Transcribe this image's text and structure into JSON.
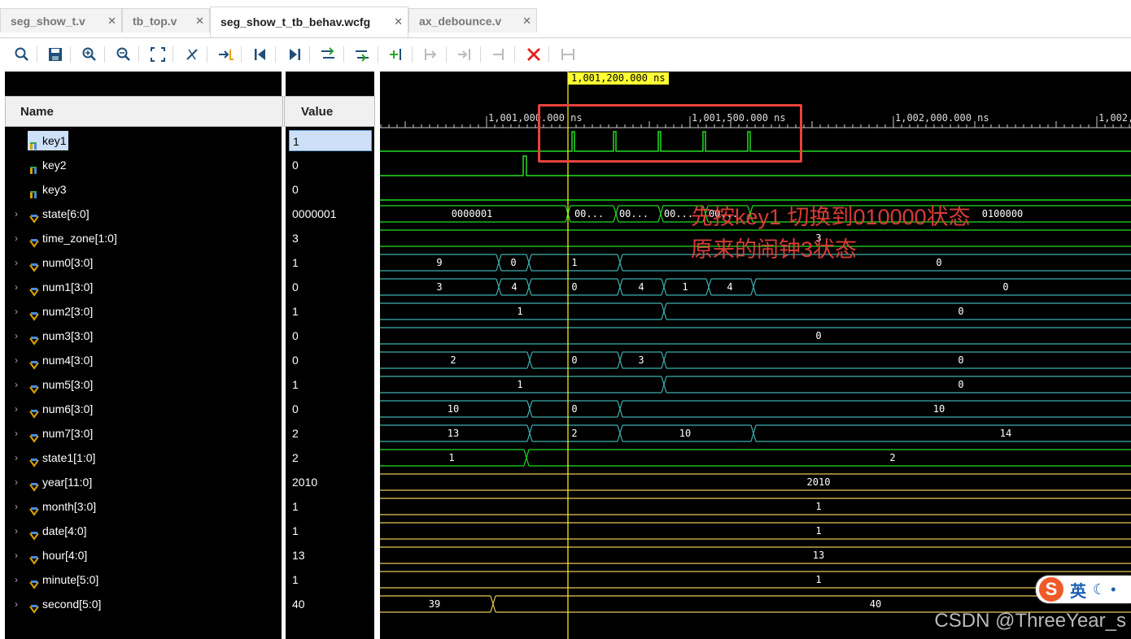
{
  "tabs": [
    {
      "label": "seg_show_t.v",
      "active": false
    },
    {
      "label": "tb_top.v",
      "active": false
    },
    {
      "label": "seg_show_t_tb_behav.wcfg",
      "active": true
    },
    {
      "label": "ax_debounce.v",
      "active": false
    }
  ],
  "toolbar": [
    "search-icon",
    "save-icon",
    "zoom-in-icon",
    "zoom-out-icon",
    "zoom-fit-icon",
    "cursor-snap-icon",
    "go-to-time-0-icon",
    "previous-edge-icon",
    "next-edge-icon",
    "add-marker-icon",
    "next-marker-icon",
    "insert-icon",
    "swap-icon",
    "disabled-icon-1",
    "disabled-icon-2",
    "delete-icon",
    "disabled-icon-3"
  ],
  "headers": {
    "name": "Name",
    "value": "Value"
  },
  "cursor": {
    "label": "1,001,200.000 ns"
  },
  "timeline": {
    "labels": [
      "1,001,000.000 ns",
      "1,001,500.000 ns",
      "1,002,000.000 ns",
      "1,002,"
    ]
  },
  "signals": [
    {
      "name": "key1",
      "value": "1",
      "type": "bit",
      "selected": true
    },
    {
      "name": "key2",
      "value": "0",
      "type": "bit"
    },
    {
      "name": "key3",
      "value": "0",
      "type": "bit"
    },
    {
      "name": "state[6:0]",
      "value": "0000001",
      "type": "bus"
    },
    {
      "name": "time_zone[1:0]",
      "value": "3",
      "type": "bus"
    },
    {
      "name": "num0[3:0]",
      "value": "1",
      "type": "bus"
    },
    {
      "name": "num1[3:0]",
      "value": "0",
      "type": "bus"
    },
    {
      "name": "num2[3:0]",
      "value": "1",
      "type": "bus"
    },
    {
      "name": "num3[3:0]",
      "value": "0",
      "type": "bus"
    },
    {
      "name": "num4[3:0]",
      "value": "0",
      "type": "bus"
    },
    {
      "name": "num5[3:0]",
      "value": "1",
      "type": "bus"
    },
    {
      "name": "num6[3:0]",
      "value": "0",
      "type": "bus"
    },
    {
      "name": "num7[3:0]",
      "value": "2",
      "type": "bus"
    },
    {
      "name": "state1[1:0]",
      "value": "2",
      "type": "bus"
    },
    {
      "name": "year[11:0]",
      "value": "2010",
      "type": "bus"
    },
    {
      "name": "month[3:0]",
      "value": "1",
      "type": "bus"
    },
    {
      "name": "date[4:0]",
      "value": "1",
      "type": "bus"
    },
    {
      "name": "hour[4:0]",
      "value": "13",
      "type": "bus"
    },
    {
      "name": "minute[5:0]",
      "value": "1",
      "type": "bus"
    },
    {
      "name": "second[5:0]",
      "value": "40",
      "type": "bus"
    }
  ],
  "wave_labels": {
    "state": [
      "0000001",
      "00...",
      "00...",
      "00...",
      "00...",
      "0100000"
    ],
    "time_zone": [
      "3"
    ],
    "num0": [
      "9",
      "0",
      "1",
      "0"
    ],
    "num1": [
      "3",
      "4",
      "0",
      "4",
      "1",
      "4",
      "0"
    ],
    "num2": [
      "1",
      "0"
    ],
    "num3": [
      "0"
    ],
    "num4": [
      "2",
      "0",
      "3",
      "0"
    ],
    "num5": [
      "1",
      "0"
    ],
    "num6": [
      "10",
      "0",
      "10"
    ],
    "num7": [
      "13",
      "2",
      "10",
      "14"
    ],
    "state1": [
      "1",
      "2"
    ],
    "year": [
      "2010"
    ],
    "month": [
      "1"
    ],
    "date": [
      "1"
    ],
    "hour": [
      "13"
    ],
    "minute": [
      "1"
    ],
    "second": [
      "39",
      "40"
    ]
  },
  "annotation": {
    "line1": "先按key1 切换到010000状态",
    "line2": "原来的闹钟3状态"
  },
  "ime": {
    "label": "英"
  },
  "watermark": "CSDN @ThreeYear_s",
  "colors": {
    "green": "#22dd22",
    "cyan": "#3fb0b0",
    "yellow_bus": "#e8c85a",
    "cursor": "#ffff00",
    "highlight": "#e8433a"
  }
}
